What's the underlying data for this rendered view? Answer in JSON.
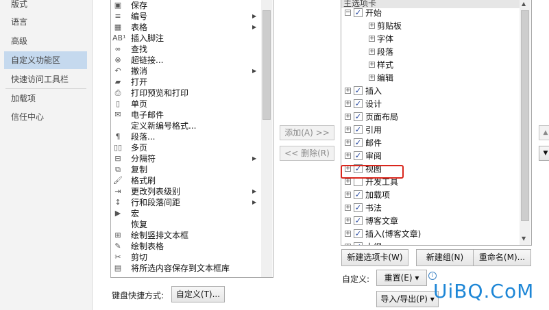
{
  "nav": {
    "items": [
      "版式",
      "语言",
      "高级",
      "自定义功能区",
      "快速访问工具栏",
      "加载项",
      "信任中心"
    ],
    "selected_index": 3
  },
  "commands": [
    {
      "label": "保存",
      "icon": "save-icon",
      "glyph": "▣",
      "submenu": false
    },
    {
      "label": "编号",
      "icon": "numbering-icon",
      "glyph": "≡",
      "submenu": true
    },
    {
      "label": "表格",
      "icon": "table-icon",
      "glyph": "▦",
      "submenu": true
    },
    {
      "label": "插入脚注",
      "icon": "footnote-icon",
      "glyph": "AB¹",
      "submenu": false
    },
    {
      "label": "查找",
      "icon": "binoculars-icon",
      "glyph": "∞",
      "submenu": false
    },
    {
      "label": "超链接...",
      "icon": "hyperlink-icon",
      "glyph": "⊗",
      "submenu": false
    },
    {
      "label": "撤消",
      "icon": "undo-icon",
      "glyph": "↶",
      "submenu": true
    },
    {
      "label": "打开",
      "icon": "folder-icon",
      "glyph": "▰",
      "submenu": false
    },
    {
      "label": "打印预览和打印",
      "icon": "print-preview-icon",
      "glyph": "⎙",
      "submenu": false
    },
    {
      "label": "单页",
      "icon": "single-page-icon",
      "glyph": "▯",
      "submenu": false
    },
    {
      "label": "电子邮件",
      "icon": "email-icon",
      "glyph": "✉",
      "submenu": false
    },
    {
      "label": "定义新编号格式...",
      "icon": "blank-icon",
      "glyph": "",
      "submenu": false
    },
    {
      "label": "段落...",
      "icon": "paragraph-icon",
      "glyph": "¶",
      "submenu": false
    },
    {
      "label": "多页",
      "icon": "multi-page-icon",
      "glyph": "▯▯",
      "submenu": false
    },
    {
      "label": "分隔符",
      "icon": "break-icon",
      "glyph": "⊟",
      "submenu": true
    },
    {
      "label": "复制",
      "icon": "copy-icon",
      "glyph": "⧉",
      "submenu": false
    },
    {
      "label": "格式刷",
      "icon": "format-painter-icon",
      "glyph": "🖌",
      "submenu": false
    },
    {
      "label": "更改列表级别",
      "icon": "list-level-icon",
      "glyph": "⇥",
      "submenu": true
    },
    {
      "label": "行和段落间距",
      "icon": "line-spacing-icon",
      "glyph": "↕",
      "submenu": true
    },
    {
      "label": "宏",
      "icon": "macro-icon",
      "glyph": "▶",
      "submenu": false
    },
    {
      "label": "恢复",
      "icon": "blank-icon",
      "glyph": "",
      "submenu": false
    },
    {
      "label": "绘制竖排文本框",
      "icon": "vertical-textbox-icon",
      "glyph": "⊞",
      "submenu": false
    },
    {
      "label": "绘制表格",
      "icon": "draw-table-icon",
      "glyph": "✎",
      "submenu": false
    },
    {
      "label": "剪切",
      "icon": "scissors-icon",
      "glyph": "✂",
      "submenu": false
    },
    {
      "label": "将所选内容保存到文本框库",
      "icon": "save-selection-icon",
      "glyph": "▤",
      "submenu": false
    }
  ],
  "middle": {
    "add": "添加(A) >>",
    "remove": "<< 删除(R)"
  },
  "tree": {
    "header": "主选项卡",
    "items": [
      {
        "label": "开始",
        "level": 0,
        "checked": true,
        "expanded": true
      },
      {
        "label": "剪贴板",
        "level": 1,
        "checked": null,
        "expanded": false
      },
      {
        "label": "字体",
        "level": 1,
        "checked": null,
        "expanded": false
      },
      {
        "label": "段落",
        "level": 1,
        "checked": null,
        "expanded": false
      },
      {
        "label": "样式",
        "level": 1,
        "checked": null,
        "expanded": false
      },
      {
        "label": "编辑",
        "level": 1,
        "checked": null,
        "expanded": false
      },
      {
        "label": "插入",
        "level": 0,
        "checked": true,
        "expanded": false
      },
      {
        "label": "设计",
        "level": 0,
        "checked": true,
        "expanded": false
      },
      {
        "label": "页面布局",
        "level": 0,
        "checked": true,
        "expanded": false
      },
      {
        "label": "引用",
        "level": 0,
        "checked": true,
        "expanded": false
      },
      {
        "label": "邮件",
        "level": 0,
        "checked": true,
        "expanded": false
      },
      {
        "label": "审阅",
        "level": 0,
        "checked": true,
        "expanded": false
      },
      {
        "label": "视图",
        "level": 0,
        "checked": true,
        "expanded": false
      },
      {
        "label": "开发工具",
        "level": 0,
        "checked": false,
        "expanded": false
      },
      {
        "label": "加载项",
        "level": 0,
        "checked": true,
        "expanded": false
      },
      {
        "label": "书法",
        "level": 0,
        "checked": true,
        "expanded": false
      },
      {
        "label": "博客文章",
        "level": 0,
        "checked": true,
        "expanded": false
      },
      {
        "label": "插入(博客文章)",
        "level": 0,
        "checked": true,
        "expanded": false
      },
      {
        "label": "大纲",
        "level": 0,
        "checked": true,
        "expanded": false
      }
    ]
  },
  "buttons": {
    "new_tab": "新建选项卡(W)",
    "new_group": "新建组(N)",
    "rename": "重命名(M)...",
    "customize_label": "自定义:",
    "reset": "重置(E) ▾",
    "import_export": "导入/导出(P) ▾",
    "keyboard_label": "键盘快捷方式:",
    "keyboard_btn": "自定义(T)..."
  },
  "watermark": "UiBQ.CoM",
  "colors": {
    "accent_selected": "#c5d9ee",
    "highlight": "#d9261c",
    "watermark": "#1d86d6"
  }
}
